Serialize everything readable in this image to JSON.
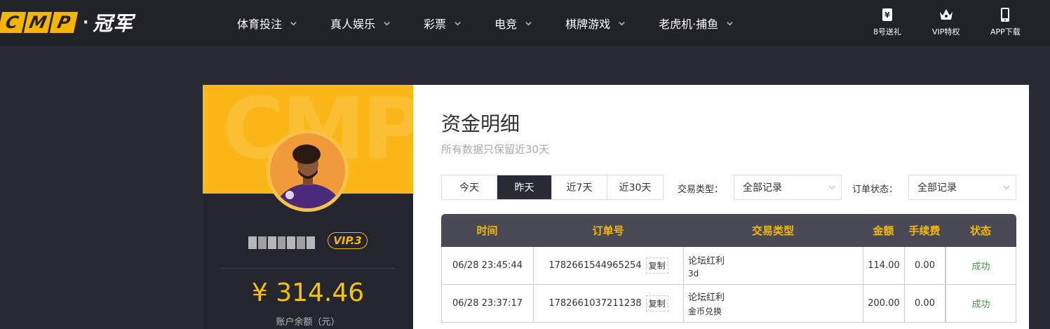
{
  "header": {
    "logo_letters": [
      "C",
      "M",
      "P"
    ],
    "logo_separator": "·",
    "logo_text": "冠军",
    "nav": [
      "体育投注",
      "真人娱乐",
      "彩票",
      "电竞",
      "棋牌游戏",
      "老虎机·捕鱼"
    ],
    "quick_links": [
      {
        "label": "8号送礼",
        "icon": "ticket-icon"
      },
      {
        "label": "VIP特权",
        "icon": "crown-icon"
      },
      {
        "label": "APP下载",
        "icon": "tablet-icon"
      }
    ]
  },
  "profile": {
    "banner_watermark": "CMP",
    "vip_level": "VIP.3",
    "balance": "¥ 314.46",
    "balance_label": "账户余额（元）"
  },
  "main": {
    "title": "资金明细",
    "subtitle": "所有数据只保留近30天",
    "range_tabs": [
      {
        "label": "今天",
        "active": false
      },
      {
        "label": "昨天",
        "active": true
      },
      {
        "label": "近7天",
        "active": false
      },
      {
        "label": "近30天",
        "active": false
      }
    ],
    "filters": {
      "type_label": "交易类型：",
      "type_value": "全部记录",
      "status_label": "订单状态：",
      "status_value": "全部记录"
    },
    "table": {
      "headers": [
        "时间",
        "订单号",
        "交易类型",
        "金额",
        "手续费",
        "状态"
      ],
      "copy_label": "复制",
      "rows": [
        {
          "time": "06/28 23:45:44",
          "order_no": "1782661544965254",
          "type": "论坛红利",
          "type_note": "3d",
          "amount": "114.00",
          "fee": "0.00",
          "status": "成功"
        },
        {
          "time": "06/28 23:37:17",
          "order_no": "1782661037211238",
          "type": "论坛红利",
          "type_note": "金币兑换",
          "amount": "200.00",
          "fee": "0.00",
          "status": "成功"
        }
      ]
    }
  },
  "colors": {
    "accent": "#f5b800",
    "dark_bg": "#2a2a35",
    "success": "#3aa23a"
  }
}
